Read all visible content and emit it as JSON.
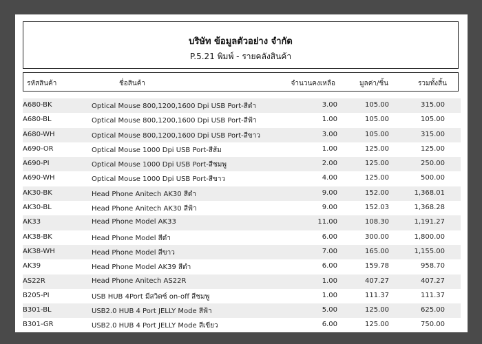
{
  "report": {
    "company": "บริษัท ข้อมูลตัวอย่าง จำกัด",
    "subtitle": "P.5.21 พิมพ์ - รายคลังสินค้า"
  },
  "columns": {
    "code": "รหัสสินค้า",
    "name": "ชื่อสินค้า",
    "qty": "จำนวนคงเหลือ",
    "unit_price": "มูลค่า/ชิ้น",
    "total": "รวมทั้งสิ้น"
  },
  "rows": [
    {
      "code": "A680-BK",
      "name": "Optical Mouse 800,1200,1600 Dpi USB Port-สีดำ",
      "qty": "3.00",
      "unit_price": "105.00",
      "total": "315.00"
    },
    {
      "code": "A680-BL",
      "name": "Optical Mouse 800,1200,1600 Dpi USB Port-สีฟ้า",
      "qty": "1.00",
      "unit_price": "105.00",
      "total": "105.00"
    },
    {
      "code": "A680-WH",
      "name": "Optical Mouse 800,1200,1600 Dpi USB Port-สีขาว",
      "qty": "3.00",
      "unit_price": "105.00",
      "total": "315.00"
    },
    {
      "code": "A690-OR",
      "name": "Optical Mouse 1000 Dpi USB Port-สีส้ม",
      "qty": "1.00",
      "unit_price": "125.00",
      "total": "125.00"
    },
    {
      "code": "A690-PI",
      "name": "Optical Mouse 1000 Dpi USB Port-สีชมพู",
      "qty": "2.00",
      "unit_price": "125.00",
      "total": "250.00"
    },
    {
      "code": "A690-WH",
      "name": "Optical Mouse 1000 Dpi USB Port-สีขาว",
      "qty": "4.00",
      "unit_price": "125.00",
      "total": "500.00"
    },
    {
      "code": "AK30-BK",
      "name": "Head Phone Anitech AK30 สีดำ",
      "qty": "9.00",
      "unit_price": "152.00",
      "total": "1,368.01"
    },
    {
      "code": "AK30-BL",
      "name": "Head Phone Anitech AK30 สีฟ้า",
      "qty": "9.00",
      "unit_price": "152.03",
      "total": "1,368.28"
    },
    {
      "code": "AK33",
      "name": "Head Phone Model AK33",
      "qty": "11.00",
      "unit_price": "108.30",
      "total": "1,191.27"
    },
    {
      "code": "AK38-BK",
      "name": "Head Phone Model  สีดำ",
      "qty": "6.00",
      "unit_price": "300.00",
      "total": "1,800.00"
    },
    {
      "code": "AK38-WH",
      "name": "Head Phone Model  สีขาว",
      "qty": "7.00",
      "unit_price": "165.00",
      "total": "1,155.00"
    },
    {
      "code": "AK39",
      "name": "Head Phone Model  AK39 สีดำ",
      "qty": "6.00",
      "unit_price": "159.78",
      "total": "958.70"
    },
    {
      "code": "AS22R",
      "name": "Head Phone Anitech AS22R",
      "qty": "1.00",
      "unit_price": "407.27",
      "total": "407.27"
    },
    {
      "code": "B205-PI",
      "name": "USB HUB 4Port มีสวิตซ์ on-off สีชมพู",
      "qty": "1.00",
      "unit_price": "111.37",
      "total": "111.37"
    },
    {
      "code": "B301-BL",
      "name": "USB2.0 HUB 4 Port JELLY Mode สีฟ้า",
      "qty": "5.00",
      "unit_price": "125.00",
      "total": "625.00"
    },
    {
      "code": "B301-GR",
      "name": "USB2.0 HUB 4 Port JELLY Mode สีเขียว",
      "qty": "6.00",
      "unit_price": "125.00",
      "total": "750.00"
    }
  ]
}
